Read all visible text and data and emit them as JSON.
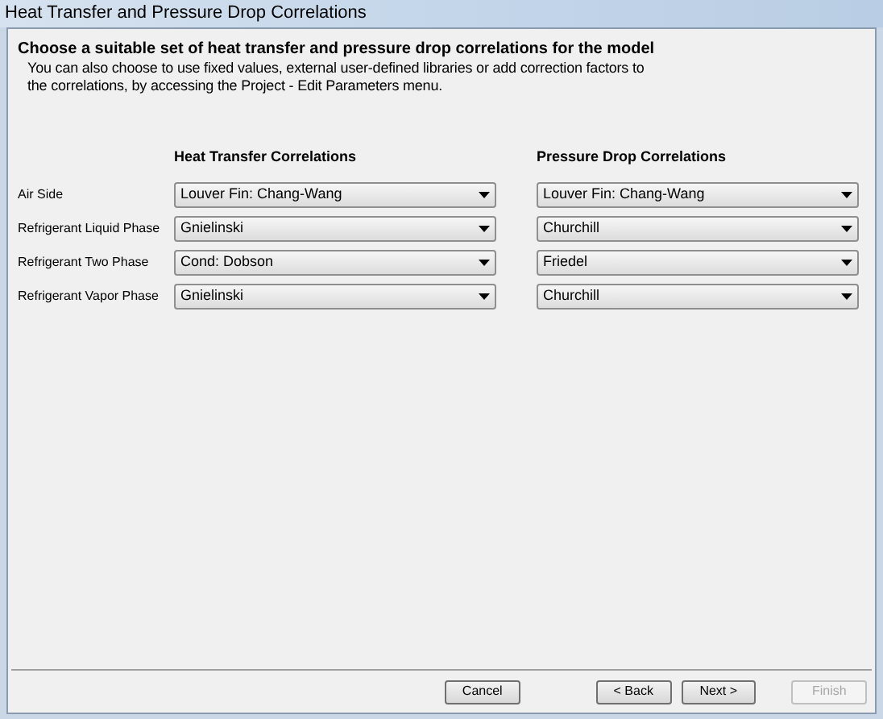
{
  "window": {
    "title": "Heat Transfer and Pressure Drop Correlations"
  },
  "header": {
    "title": "Choose a suitable set of heat transfer and pressure drop correlations for the model",
    "description": "You can also choose to use fixed values, external user-defined libraries or add correction factors to the correlations, by accessing the Project - Edit Parameters menu."
  },
  "columns": [
    "Heat Transfer Correlations",
    "Pressure Drop Correlations"
  ],
  "rows": [
    {
      "label": "Air Side",
      "heat_transfer": "Louver Fin: Chang-Wang",
      "pressure_drop": "Louver Fin: Chang-Wang"
    },
    {
      "label": "Refrigerant Liquid Phase",
      "heat_transfer": "Gnielinski",
      "pressure_drop": "Churchill"
    },
    {
      "label": "Refrigerant Two Phase",
      "heat_transfer": "Cond: Dobson",
      "pressure_drop": "Friedel"
    },
    {
      "label": "Refrigerant Vapor Phase",
      "heat_transfer": "Gnielinski",
      "pressure_drop": "Churchill"
    }
  ],
  "buttons": [
    {
      "label": "Cancel",
      "disabled": false
    },
    {
      "label": "< Back",
      "disabled": false
    },
    {
      "label": "Next >",
      "disabled": false
    },
    {
      "label": "Finish",
      "disabled": true
    }
  ]
}
